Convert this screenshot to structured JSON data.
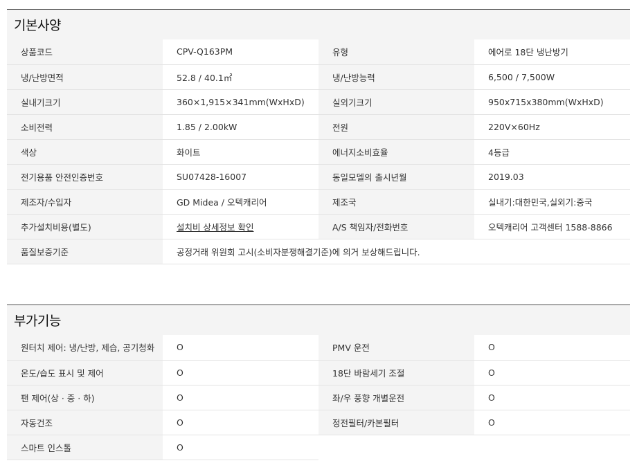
{
  "basic": {
    "title": "기본사양",
    "rows": [
      [
        "상품코드",
        "CPV-Q163PM",
        "유형",
        "에어로 18단 냉난방기"
      ],
      [
        "냉/난방면적",
        "52.8 / 40.1㎡",
        "냉/난방능력",
        "6,500 / 7,500W"
      ],
      [
        "실내기크기",
        "360×1,915×341mm(WxHxD)",
        "실외기크기",
        "950x715x380mm(WxHxD)"
      ],
      [
        "소비전력",
        "1.85 / 2.00kW",
        "전원",
        "220V×60Hz"
      ],
      [
        "색상",
        "화이트",
        "에너지소비효율",
        "4등급"
      ],
      [
        "전기용품 안전인증번호",
        "SU07428-16007",
        "동일모델의 출시년월",
        "2019.03"
      ],
      [
        "제조자/수입자",
        "GD Midea / 오텍캐리어",
        "제조국",
        "실내기:대한민국,실외기:중국"
      ],
      [
        "추가설치비용(별도)",
        "설치비 상세정보 확인",
        "A/S 책임자/전화번호",
        "오텍캐리어 고객센터 1588-8866"
      ]
    ],
    "warranty_label": "품질보증기준",
    "warranty_value": "공정거래 위원회 고시(소비자분쟁해결기준)에 의거 보상해드립니다."
  },
  "extra": {
    "title": "부가기능",
    "rows": [
      [
        "원터치 제어: 냉/난방, 제습, 공기청화",
        "O",
        "PMV 운전",
        "O"
      ],
      [
        "온도/습도 표시 및 제어",
        "O",
        "18단 바람세기 조절",
        "O"
      ],
      [
        "팬 제어(상 · 중 · 하)",
        "O",
        "좌/우 풍향 개별운전",
        "O"
      ],
      [
        "자동건조",
        "O",
        "정전필터/카본필터",
        "O"
      ]
    ],
    "last_label": "스마트 인스톨",
    "last_value": "O"
  }
}
